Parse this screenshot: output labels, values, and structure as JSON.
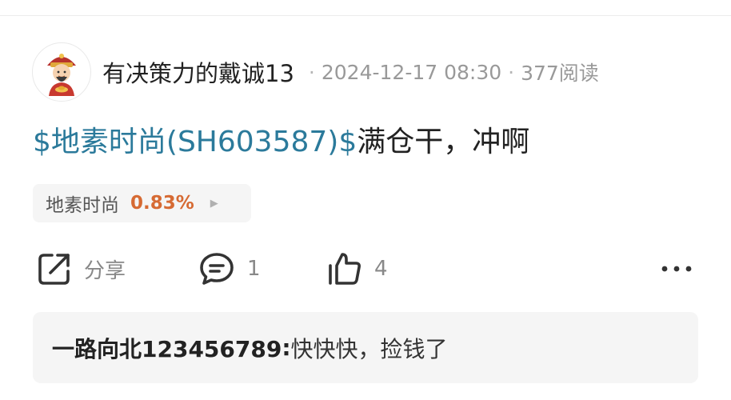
{
  "post": {
    "author": "有决策力的戴诚13",
    "separator": "·",
    "datetime": "2024-12-17 08:30",
    "views": "377阅读",
    "stock_tag": "$地素时尚(SH603587)$",
    "text": "满仓干，冲啊"
  },
  "stock_chip": {
    "name": "地素时尚",
    "change": "0.83%",
    "change_color": "#d66a33"
  },
  "actions": {
    "share_label": "分享",
    "comment_count": "1",
    "like_count": "4"
  },
  "comment": {
    "author": "一路向北123456789",
    "colon": ":",
    "text": " 快快快，捡钱了"
  },
  "colors": {
    "link": "#2b7a9b",
    "meta": "#999999",
    "chip_bg": "#f5f5f5"
  },
  "icons": {
    "avatar": "cartoon-god-of-wealth-avatar",
    "share": "share-icon",
    "comment": "comment-icon",
    "like": "thumbs-up-icon",
    "more": "more-icon",
    "chip_arrow": "triangle-right-icon"
  }
}
